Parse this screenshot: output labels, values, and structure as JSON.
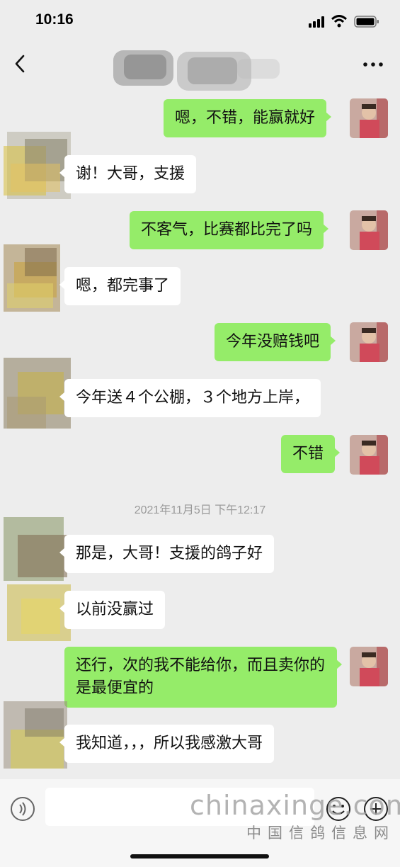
{
  "status_bar": {
    "time": "10:16"
  },
  "messages": [
    {
      "side": "right",
      "text": "嗯，不错，能赢就好"
    },
    {
      "side": "left",
      "text": "谢！大哥，支援"
    },
    {
      "side": "right",
      "text": "不客气，比赛都比完了吗"
    },
    {
      "side": "left",
      "text": "嗯，都完事了"
    },
    {
      "side": "right",
      "text": "今年没赔钱吧"
    },
    {
      "side": "left",
      "text": "今年送４个公棚，３个地方上岸，"
    },
    {
      "side": "right",
      "text": "不错"
    },
    {
      "side": "left",
      "text": "那是，大哥！支援的鸽子好"
    },
    {
      "side": "left",
      "text": "以前没赢过"
    },
    {
      "side": "right",
      "text": "还行，次的我不能给你，而且卖你的是最便宜的"
    },
    {
      "side": "left",
      "text": "我知道，，，所以我感激大哥"
    }
  ],
  "timestamp": "2021年11月5日 下午12:17",
  "watermark": {
    "main": "chinaxinge.com",
    "sub": "中国信鸽信息网"
  },
  "colors": {
    "outgoing_bubble": "#95ec69",
    "incoming_bubble": "#ffffff",
    "background": "#ededed"
  },
  "icons": [
    "signal-icon",
    "wifi-icon",
    "battery-icon",
    "back-icon",
    "more-icon",
    "voice-icon",
    "emoji-icon",
    "plus-icon"
  ]
}
